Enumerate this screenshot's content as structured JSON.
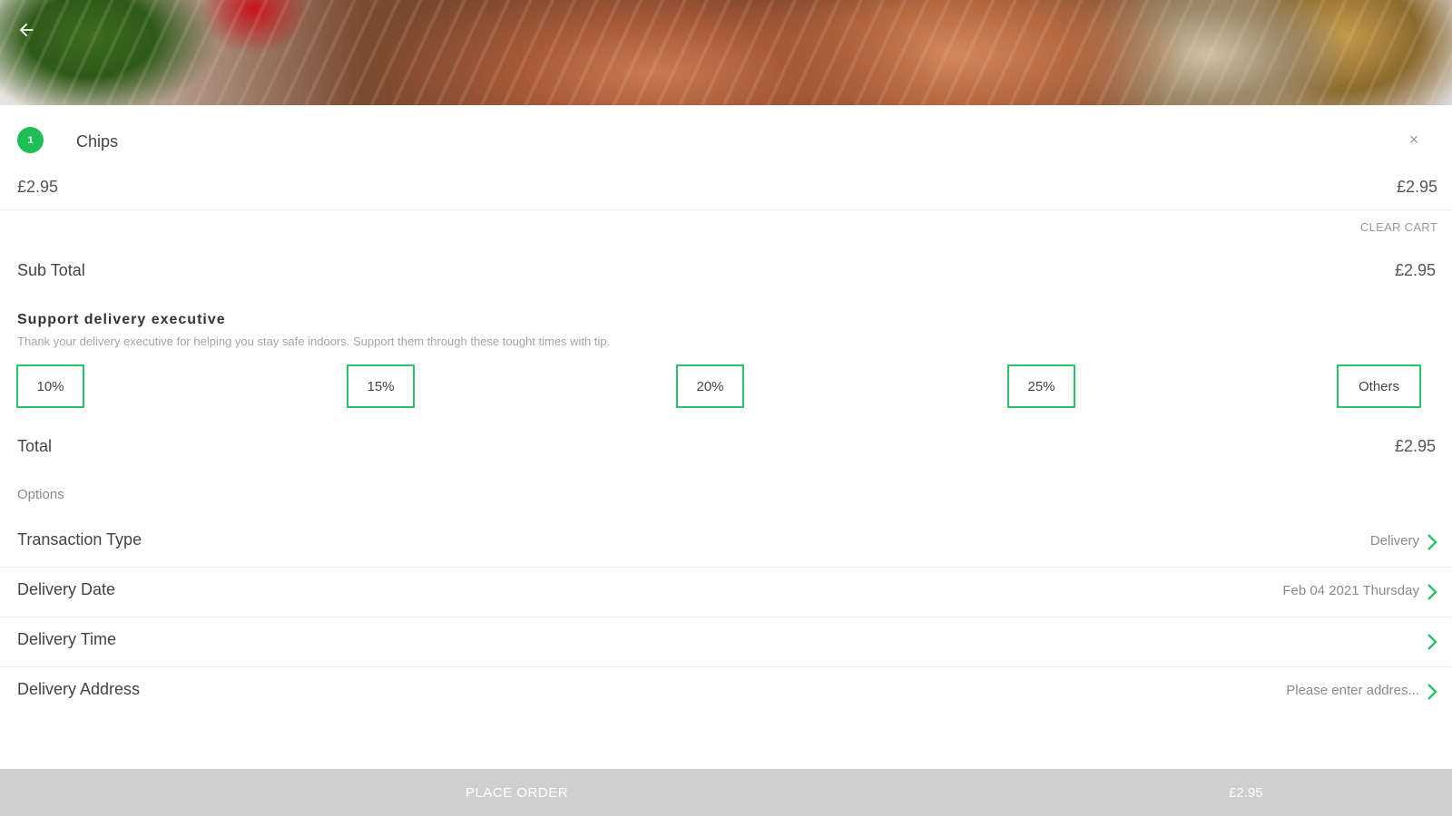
{
  "header": {
    "back_icon": "arrow-left-icon",
    "hero_image": "salmon-dish-photo"
  },
  "cart": {
    "items": [
      {
        "qty": "1",
        "name": "Chips",
        "unit_price": "£2.95",
        "line_total": "£2.95"
      }
    ],
    "remove_icon": "close-icon",
    "clear_cart_label": "CLEAR CART"
  },
  "summary": {
    "subtotal_label": "Sub Total",
    "subtotal_value": "£2.95",
    "total_label": "Total",
    "total_value": "£2.95"
  },
  "tip": {
    "title": "Support delivery executive",
    "description": "Thank your delivery executive for helping you stay safe indoors. Support them through these tought times with tip.",
    "options": [
      "10%",
      "15%",
      "20%",
      "25%",
      "Others"
    ]
  },
  "options": {
    "section_label": "Options",
    "rows": [
      {
        "label": "Transaction Type",
        "value": "Delivery"
      },
      {
        "label": "Delivery Date",
        "value": "Feb 04 2021 Thursday"
      },
      {
        "label": "Delivery Time",
        "value": ""
      },
      {
        "label": "Delivery Address",
        "value": "Please enter addres..."
      }
    ]
  },
  "footer": {
    "place_order_label": "PLACE ORDER",
    "total": "£2.95"
  },
  "colors": {
    "accent": "#1fbf55",
    "tip_border": "#2cc26a",
    "bottom_bar": "#cfcfcf"
  }
}
